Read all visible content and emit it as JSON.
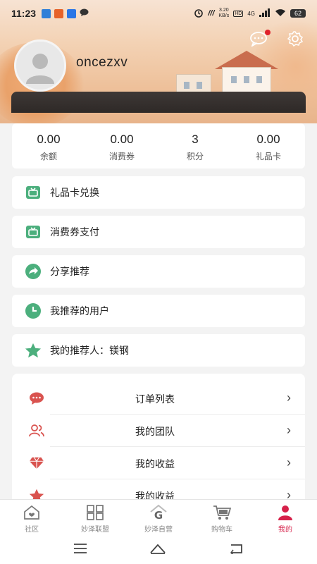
{
  "status_bar": {
    "time": "11:23",
    "net_speed": "3.20",
    "net_unit": "KB/s",
    "hd": "HD",
    "signal_type": "4G",
    "battery": "62"
  },
  "profile": {
    "username": "oncezxv"
  },
  "stats": [
    {
      "value": "0.00",
      "label": "余额"
    },
    {
      "value": "0.00",
      "label": "消费券"
    },
    {
      "value": "3",
      "label": "积分"
    },
    {
      "value": "0.00",
      "label": "礼品卡"
    }
  ],
  "menu": [
    {
      "label": "礼品卡兑换",
      "icon": "wallet-icon"
    },
    {
      "label": "消费券支付",
      "icon": "wallet-icon"
    },
    {
      "label": "分享推荐",
      "icon": "share-icon"
    },
    {
      "label": "我推荐的用户",
      "icon": "clock-icon"
    },
    {
      "label": "我的推荐人：镁钢",
      "icon": "star-icon"
    }
  ],
  "list": [
    {
      "label": "订单列表",
      "icon": "chat-icon"
    },
    {
      "label": "我的团队",
      "icon": "team-icon"
    },
    {
      "label": "我的收益",
      "icon": "diamond-icon"
    },
    {
      "label": "我的收益",
      "icon": "star-icon"
    }
  ],
  "tabs": [
    {
      "label": "社区",
      "icon": "home-icon",
      "active": false
    },
    {
      "label": "妙泽联盟",
      "icon": "grid-icon",
      "active": false
    },
    {
      "label": "妙泽自营",
      "icon": "g-home-icon",
      "active": false
    },
    {
      "label": "购物车",
      "icon": "cart-icon",
      "active": false
    },
    {
      "label": "我的",
      "icon": "user-icon",
      "active": true
    }
  ],
  "colors": {
    "accent": "#d6214a",
    "green_icon": "#4caf7d",
    "list_icon": "#d9534f"
  }
}
